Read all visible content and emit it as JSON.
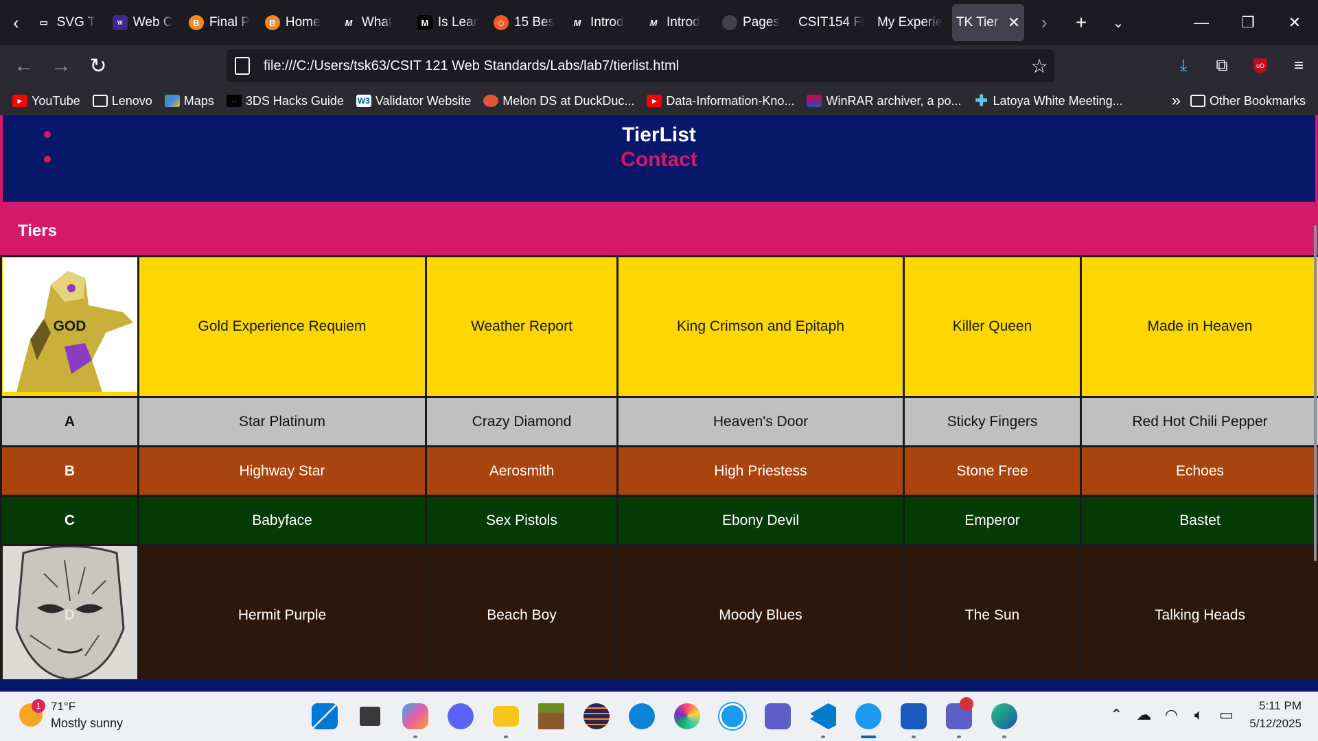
{
  "tabs": [
    {
      "label": "SVG T",
      "icon": "page-icon",
      "color": "#1c1b22"
    },
    {
      "label": "Web C",
      "icon": "wcag-icon",
      "color": "#3b2a8a"
    },
    {
      "label": "Final P",
      "icon": "b-icon",
      "color": "#f08a24"
    },
    {
      "label": "Home",
      "icon": "b-icon",
      "color": "#f08a24"
    },
    {
      "label": "What",
      "icon": "m-icon",
      "color": "#1c1b22"
    },
    {
      "label": "Is Lear",
      "icon": "medium-icon",
      "color": "#000000"
    },
    {
      "label": "15 Bes",
      "icon": "chat-icon",
      "color": "#f05a24"
    },
    {
      "label": "Introd",
      "icon": "m-icon",
      "color": "#1c1b22"
    },
    {
      "label": "Introd",
      "icon": "m-icon",
      "color": "#1c1b22"
    },
    {
      "label": "Pages",
      "icon": "github-icon",
      "color": "#1c1b22"
    },
    {
      "label": "CSIT154 Fi",
      "icon": "none",
      "color": "#1c1b22"
    },
    {
      "label": "My Experie",
      "icon": "none",
      "color": "#1c1b22"
    }
  ],
  "active_tab": {
    "label": "TK Tier"
  },
  "url": "file:///C:/Users/tsk63/CSIT 121 Web Standards/Labs/lab7/tierlist.html",
  "bookmarks": [
    {
      "label": "YouTube",
      "icon": "youtube-icon",
      "color": "#ff0000"
    },
    {
      "label": "Lenovo",
      "icon": "folder-icon",
      "color": "#2b2a33"
    },
    {
      "label": "Maps",
      "icon": "maps-icon",
      "color": "#34a853"
    },
    {
      "label": "3DS Hacks Guide",
      "icon": "3ds-icon",
      "color": "#000000"
    },
    {
      "label": "Validator Website",
      "icon": "w3c-icon",
      "color": "#ffffff"
    },
    {
      "label": "Melon DS at DuckDuc...",
      "icon": "duckduckgo-icon",
      "color": "#de5833"
    },
    {
      "label": "Data-Information-Kno...",
      "icon": "youtube-icon",
      "color": "#ff0000"
    },
    {
      "label": "WinRAR archiver, a po...",
      "icon": "winrar-icon",
      "color": "#8b1a8b"
    },
    {
      "label": "Latoya White Meeting...",
      "icon": "plus-icon",
      "color": "#5ac8e8"
    }
  ],
  "other_bookmarks": "Other Bookmarks",
  "page": {
    "nav_links": [
      "TierList",
      "Contact"
    ],
    "tiers_heading": "Tiers",
    "tiers": [
      {
        "label": "GOD",
        "image": "gold-experience-requiem-image",
        "items": [
          "Gold Experience Requiem",
          "Weather Report",
          "King Crimson and Epitaph",
          "Killer Queen",
          "Made in Heaven"
        ]
      },
      {
        "label": "A",
        "items": [
          "Star Platinum",
          "Crazy Diamond",
          "Heaven's Door",
          "Sticky Fingers",
          "Red Hot Chili Pepper"
        ]
      },
      {
        "label": "B",
        "items": [
          "Highway Star",
          "Aerosmith",
          "High Priestess",
          "Stone Free",
          "Echoes"
        ]
      },
      {
        "label": "C",
        "items": [
          "Babyface",
          "Sex Pistols",
          "Ebony Devil",
          "Emperor",
          "Bastet"
        ]
      },
      {
        "label": "D",
        "image": "stone-mask-image",
        "items": [
          "Hermit Purple",
          "Beach Boy",
          "Moody Blues",
          "The Sun",
          "Talking Heads"
        ]
      }
    ],
    "colors": {
      "nav_bg": "#07186b",
      "accent": "#d4186a",
      "s": "#ffd700",
      "a": "#c0c0c0",
      "b": "#a9440f",
      "c": "#043b04",
      "d": "#2c180b"
    }
  },
  "taskbar": {
    "weather_temp": "71°F",
    "weather_cond": "Mostly sunny",
    "weather_badge": "1",
    "time": "5:11 PM",
    "date": "5/12/2025",
    "apps": [
      "windows-start-icon",
      "file-explorer-icon",
      "copilot-icon",
      "discord-icon",
      "folder-icon",
      "minecraft-icon",
      "eclipse-icon",
      "mail-icon",
      "paint-icon",
      "safari-icon",
      "teams-icon",
      "vscode-icon",
      "browser-icon",
      "word-icon",
      "teams-tk-icon",
      "edge-icon"
    ]
  }
}
